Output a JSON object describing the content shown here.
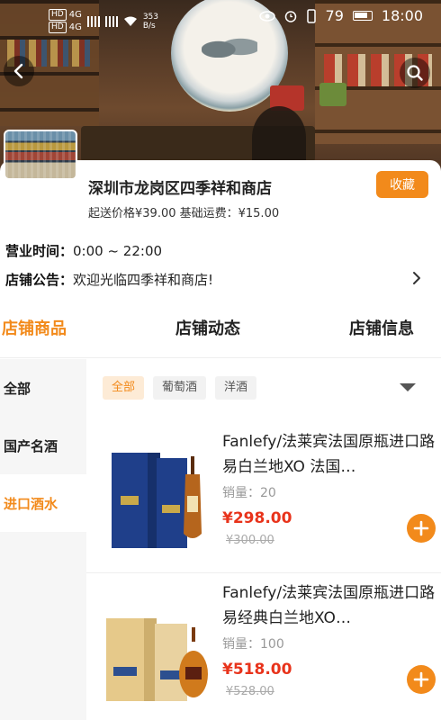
{
  "status_bar": {
    "hd1": "HD",
    "net1": "4G",
    "hd2": "HD",
    "net2": "4G",
    "speed": "353\nB/s",
    "battery": "79",
    "time": "18:00"
  },
  "store": {
    "name": "深圳市龙岗区四季祥和商店",
    "sub": "起送价格¥39.00 基础运费：¥15.00",
    "favorite_label": "收藏",
    "hours_key": "营业时间：",
    "hours_val": "0:00 ~ 22:00",
    "notice_key": "店铺公告：",
    "notice_val": "欢迎光临四季祥和商店!"
  },
  "tabs": [
    {
      "label": "店铺商品"
    },
    {
      "label": "店铺动态"
    },
    {
      "label": "店铺信息"
    }
  ],
  "categories": [
    {
      "label": "全部"
    },
    {
      "label": "国产名酒"
    },
    {
      "label": "进口酒水"
    }
  ],
  "filters": [
    {
      "label": "全部"
    },
    {
      "label": "葡萄酒"
    },
    {
      "label": "洋酒"
    }
  ],
  "products": [
    {
      "title": "Fanlefy/法莱宾法国原瓶进口路易白兰地XO 法国…",
      "sales": "销量：20",
      "price": "¥298.00",
      "old_price": "¥300.00",
      "box_color": "#1f3f8a",
      "bottle_color": "#b5651d"
    },
    {
      "title": "Fanlefy/法莱宾法国原瓶进口路易经典白兰地XO…",
      "sales": "销量：100",
      "price": "¥518.00",
      "old_price": "¥528.00",
      "box_color": "#e6c98a",
      "bottle_color": "#d07a1c"
    }
  ],
  "colors": {
    "accent": "#f28a1b",
    "price": "#e8331b"
  }
}
